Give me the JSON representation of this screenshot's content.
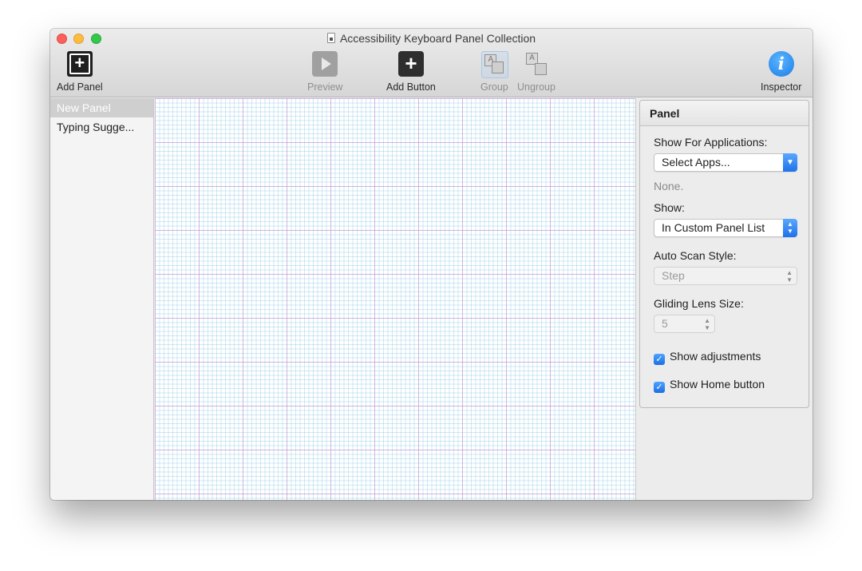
{
  "window": {
    "title": "Accessibility Keyboard Panel Collection"
  },
  "toolbar": {
    "add_panel": "Add Panel",
    "preview": "Preview",
    "add_button": "Add Button",
    "group": "Group",
    "ungroup": "Ungroup",
    "inspector": "Inspector"
  },
  "sidebar": {
    "items": [
      {
        "label": "New Panel",
        "selected": true
      },
      {
        "label": "Typing Sugge..."
      }
    ]
  },
  "inspector": {
    "header": "Panel",
    "show_for_apps_label": "Show For Applications:",
    "show_for_apps_value": "Select Apps...",
    "none_text": "None.",
    "show_label": "Show:",
    "show_value": "In Custom Panel List",
    "auto_scan_label": "Auto Scan Style:",
    "auto_scan_value": "Step",
    "gliding_lens_label": "Gliding Lens Size:",
    "gliding_lens_value": "5",
    "show_adjustments": {
      "label": "Show adjustments",
      "checked": true
    },
    "show_home_button": {
      "label": "Show Home button",
      "checked": true
    }
  },
  "colors": {
    "accent": "#1d72e8",
    "close": "#fc605c",
    "minimize": "#fdbc40",
    "maximize": "#34c84a"
  }
}
